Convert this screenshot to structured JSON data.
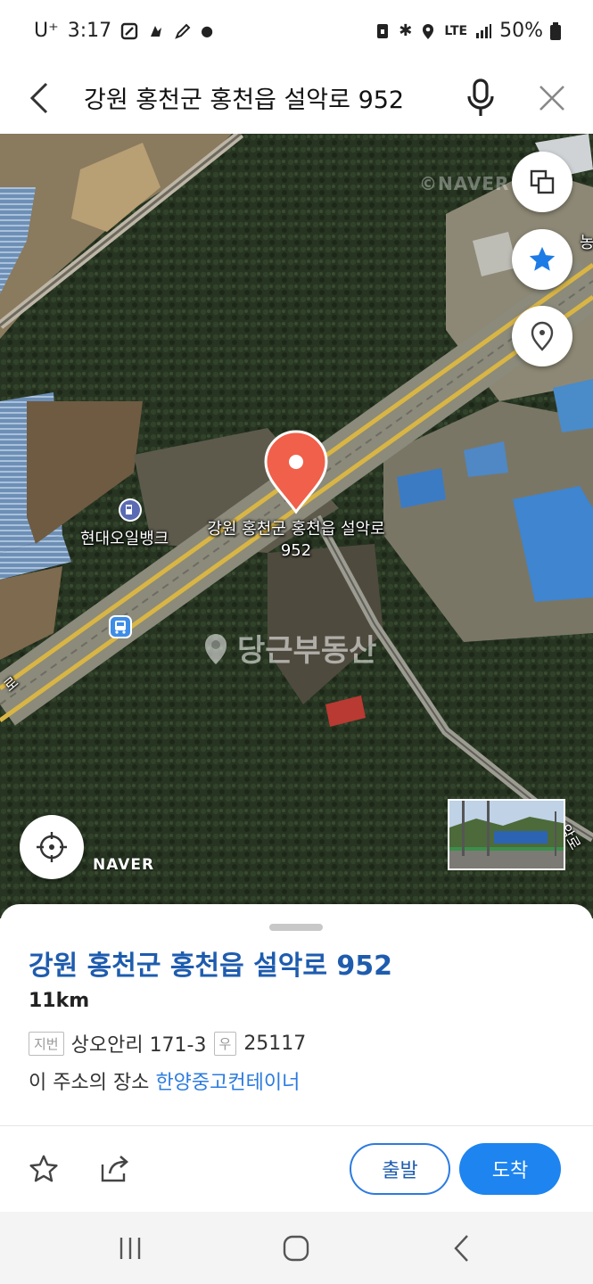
{
  "status_bar": {
    "carrier": "U⁺",
    "time": "3:17",
    "network": "LTE",
    "battery": "50%"
  },
  "search": {
    "query": "강원 홍천군 홍천읍 설악로 952"
  },
  "map": {
    "pin_label": "강원 홍천군 홍천읍 설악로 952",
    "gas_station_label": "현대오일뱅크",
    "naver_logo": "NAVER",
    "watermark": "당근부동산",
    "naver_watermark": "©NAVER",
    "road_label_left": "로",
    "road_label_right": "악로",
    "edge_label": "농",
    "pin_color": "#f0604a"
  },
  "place": {
    "title": "강원 홍천군 홍천읍 설악로 952",
    "distance": "11km",
    "jibun_tag": "지번",
    "jibun": "상오안리 171-3",
    "postal_tag": "우",
    "postal_code": "25117",
    "place_prefix": "이 주소의 장소",
    "place_name": "한양중고컨테이너",
    "depart_label": "출발",
    "arrive_label": "도착",
    "accent_color": "#1d84f0"
  }
}
